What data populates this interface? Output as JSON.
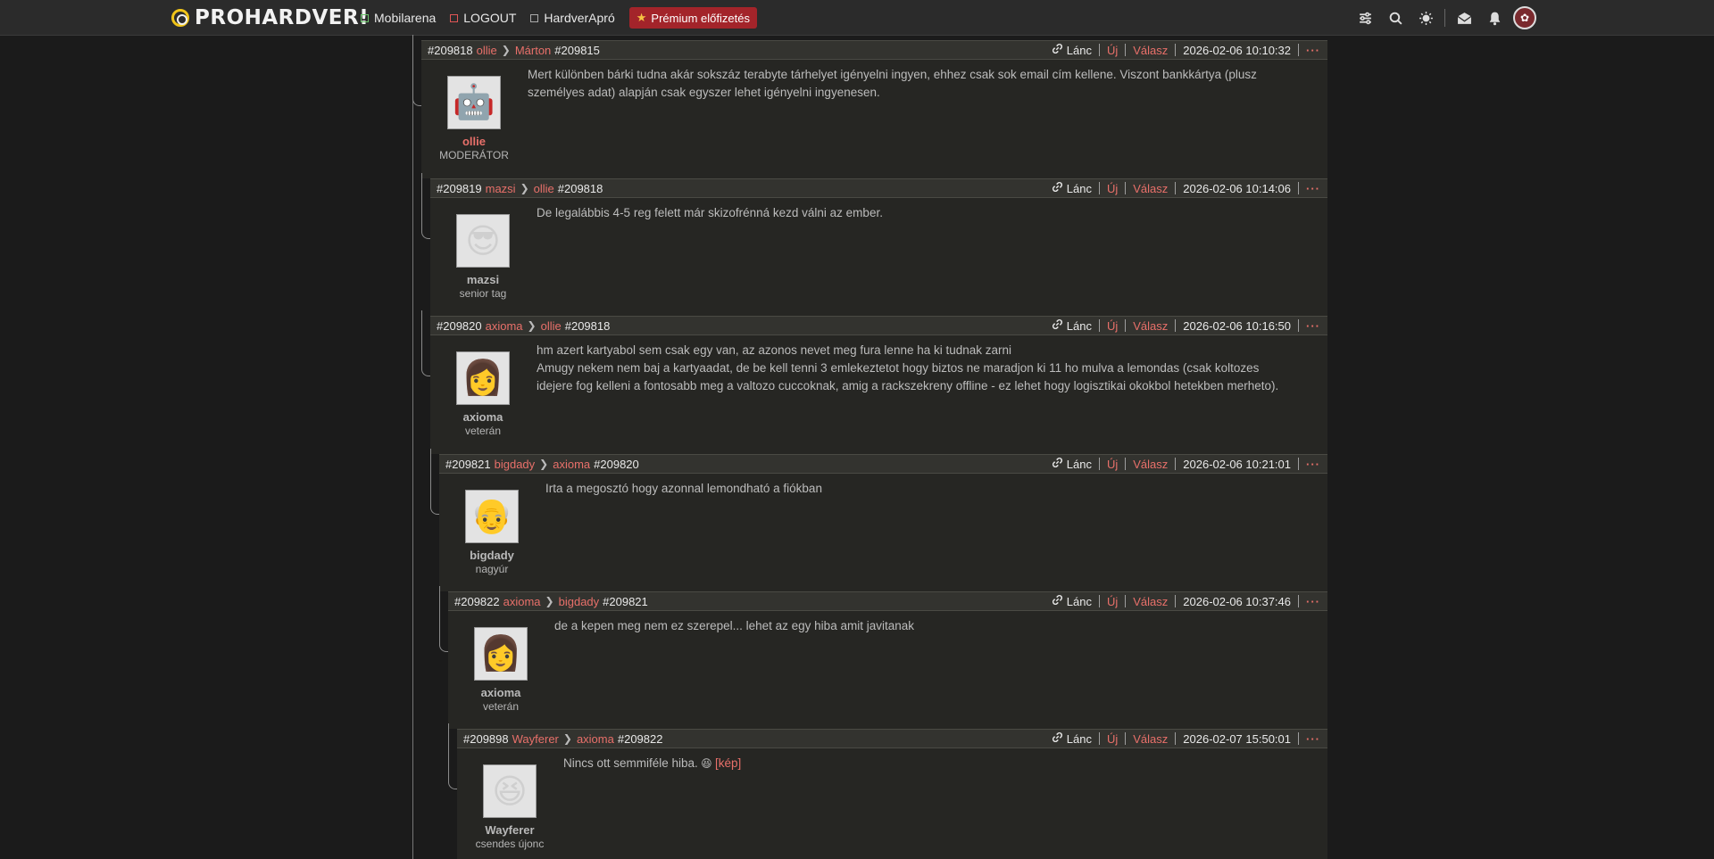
{
  "nav": {
    "logo": "PROHARDVER!",
    "links": [
      "Mobilarena",
      "LOGOUT",
      "HardverApró"
    ],
    "premium": "Prémium előfizetés"
  },
  "actions": {
    "chain": "Lánc",
    "new": "Új",
    "reply": "Válasz",
    "more": "···"
  },
  "posts": [
    {
      "id": "#209818",
      "author": "ollie",
      "target": "Márton",
      "ref": "#209815",
      "date": "2026-02-06 10:10:32",
      "name": "ollie",
      "rank": "MODERÁTOR",
      "text": [
        "Mert különben bárki tudna akár sokszáz terabyte tárhelyet igényelni ingyen, ehhez csak sok email cím kellene. Viszont bankkártya (plusz",
        "személyes adat) alapján csak egyszer lehet igényelni ingyenesen."
      ]
    },
    {
      "id": "#209819",
      "author": "mazsi",
      "target": "ollie",
      "ref": "#209818",
      "date": "2026-02-06 10:14:06",
      "name": "mazsi",
      "rank": "senior tag",
      "text": [
        "De legalábbis 4-5 reg felett már skizofrénná kezd válni az ember."
      ]
    },
    {
      "id": "#209820",
      "author": "axioma",
      "target": "ollie",
      "ref": "#209818",
      "date": "2026-02-06 10:16:50",
      "name": "axioma",
      "rank": "veterán",
      "text": [
        "hm azert kartyabol sem csak egy van, az azonos nevet meg fura lenne ha ki tudnak zarni",
        "Amugy nekem nem baj a kartyaadat, de be kell tenni 3 emlekeztetot hogy biztos ne maradjon ki 11 ho mulva a lemondas (csak koltozes",
        "idejere fog kelleni a fontosabb meg a valtozo cuccoknak, amig a rackszekreny offline - ez lehet hogy logisztikai okokbol hetekben merheto)."
      ]
    },
    {
      "id": "#209821",
      "author": "bigdady",
      "target": "axioma",
      "ref": "#209820",
      "date": "2026-02-06 10:21:01",
      "name": "bigdady",
      "rank": "nagyúr",
      "text": [
        "Irta a megosztó hogy azonnal lemondható a fiókban"
      ]
    },
    {
      "id": "#209822",
      "author": "axioma",
      "target": "bigdady",
      "ref": "#209821",
      "date": "2026-02-06 10:37:46",
      "name": "axioma",
      "rank": "veterán",
      "text": [
        "de a kepen meg nem ez szerepel... lehet az egy hiba amit javitanak"
      ]
    },
    {
      "id": "#209898",
      "author": "Wayferer",
      "target": "axioma",
      "ref": "#209822",
      "date": "2026-02-07 15:50:01",
      "name": "Wayferer",
      "rank": "csendes újonc",
      "text": [
        "Nincs ott semmiféle hiba."
      ],
      "link": "[kép]"
    }
  ]
}
